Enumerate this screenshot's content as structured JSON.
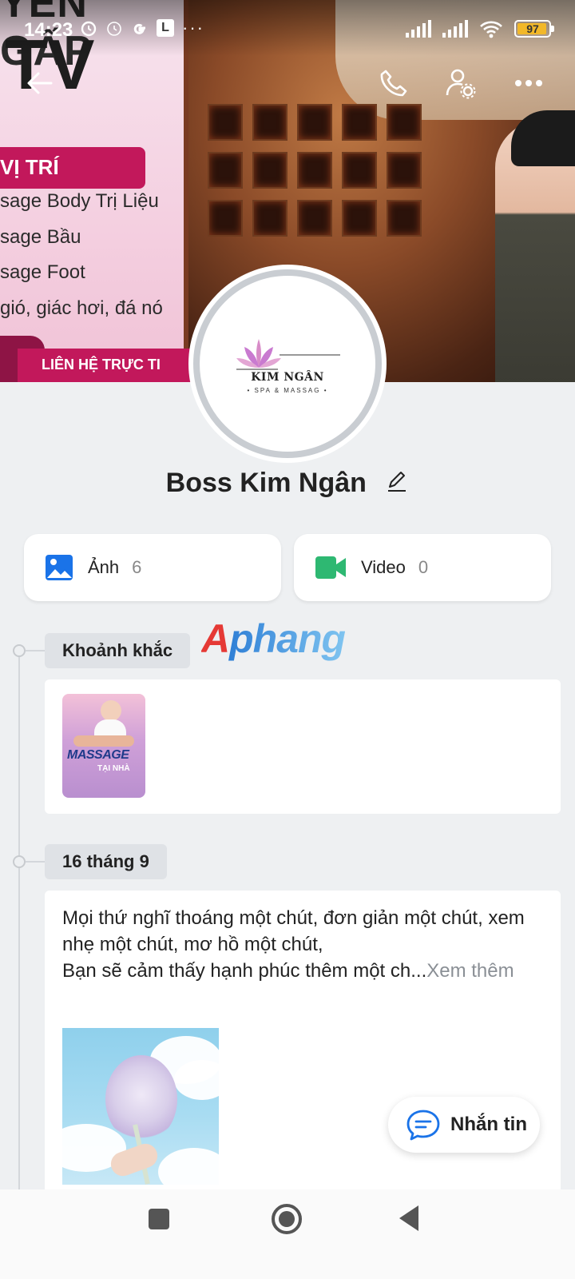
{
  "status_bar": {
    "time": "14:23",
    "notification_letter": "L",
    "more": "···",
    "battery": "97"
  },
  "cover": {
    "headline": "YÊN GẤP",
    "tv": "TV",
    "badge": "VỊ TRÍ",
    "lines": [
      "sage Body Trị Liệu",
      "sage Bầu",
      "sage Foot",
      "gió, giác hơi, đá nó"
    ],
    "cta": "LIÊN HỆ TRỰC TI"
  },
  "avatar": {
    "brand_name": "KIM NGÂN",
    "brand_sub": "• SPA & MASSAG •"
  },
  "profile": {
    "name": "Boss Kim Ngân"
  },
  "media": {
    "photos": {
      "label": "Ảnh",
      "count": "6"
    },
    "videos": {
      "label": "Video",
      "count": "0"
    }
  },
  "watermark": "Aphang",
  "timeline": {
    "moments_label": "Khoảnh khắc",
    "moments_thumb": {
      "title": "MASSAGE",
      "subtitle": "TẠI NHÀ"
    },
    "date_label": "16 tháng 9",
    "post": {
      "text": "Mọi thứ nghĩ thoáng một chút, đơn giản một chút, xem nhẹ một chút, mơ hồ một chút,\nBạn sẽ cảm thấy hạnh phúc thêm một ch...",
      "more": "Xem thêm"
    }
  },
  "message_button": {
    "label": "Nhắn tin"
  },
  "colors": {
    "accent": "#1a73e8",
    "video_green": "#2eb872",
    "brand_pink": "#c2185b"
  },
  "icons": [
    "back-arrow-icon",
    "phone-icon",
    "user-settings-icon",
    "more-icon",
    "photo-icon",
    "video-icon",
    "edit-icon",
    "chat-icon"
  ]
}
